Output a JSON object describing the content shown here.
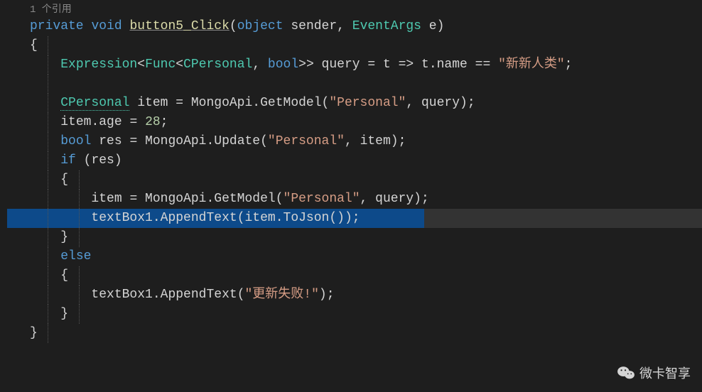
{
  "codelens": "1 个引用",
  "code": {
    "line1": {
      "kw_private": "private",
      "kw_void": "void",
      "method": "button5_Click",
      "kw_object": "object",
      "param1": "sender",
      "type_eventargs": "EventArgs",
      "param2": "e"
    },
    "line2": {
      "brace": "{"
    },
    "line3": {
      "type_expression": "Expression",
      "type_func": "Func",
      "type_cpersonal": "CPersonal",
      "kw_bool": "bool",
      "var_query": "query",
      "var_t": "t",
      "prop_name": "name",
      "str_val": "\"新新人类\""
    },
    "line5": {
      "type_cpersonal": "CPersonal",
      "var_item": "item",
      "cls_mongoapi": "MongoApi",
      "method_getmodel": "GetModel",
      "str_personal": "\"Personal\"",
      "var_query": "query"
    },
    "line6": {
      "var_item": "item",
      "prop_age": "age",
      "num_28": "28"
    },
    "line7": {
      "kw_bool": "bool",
      "var_res": "res",
      "cls_mongoapi": "MongoApi",
      "method_update": "Update",
      "str_personal": "\"Personal\"",
      "var_item": "item"
    },
    "line8": {
      "kw_if": "if",
      "var_res": "res"
    },
    "line9": {
      "brace": "{"
    },
    "line10": {
      "var_item": "item",
      "cls_mongoapi": "MongoApi",
      "method_getmodel": "GetModel",
      "str_personal": "\"Personal\"",
      "var_query": "query"
    },
    "line11": {
      "var_textbox": "textBox1",
      "method_appendtext": "AppendText",
      "var_item": "item",
      "method_tojson": "ToJson"
    },
    "line12": {
      "brace": "}"
    },
    "line13": {
      "kw_else": "else"
    },
    "line14": {
      "brace": "{"
    },
    "line15": {
      "var_textbox": "textBox1",
      "method_appendtext": "AppendText",
      "str_fail": "\"更新失败!\""
    },
    "line16": {
      "brace": "}"
    },
    "line17": {
      "brace": "}"
    }
  },
  "watermark": "微卡智享"
}
